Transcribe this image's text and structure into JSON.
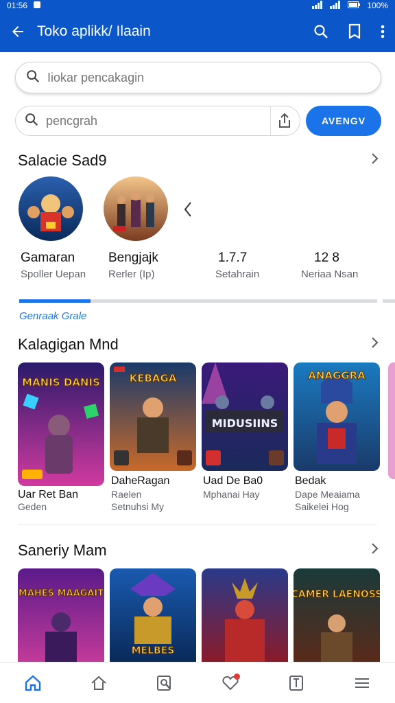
{
  "status": {
    "time": "01:56",
    "battery": "100%"
  },
  "appbar": {
    "title": "Toko aplikk/ Ilaain"
  },
  "search_main": {
    "placeholder": "Iiokar pencakagin"
  },
  "search_secondary": {
    "placeholder": "pencgrah"
  },
  "primary_button": {
    "label": "AVENGV"
  },
  "section1": {
    "title": "Salacie Sad9"
  },
  "stats": [
    {
      "value": "Gamaran",
      "label": "Spoller Uepan"
    },
    {
      "value": "Bengjajk",
      "label": "Rerler (Ip)"
    },
    {
      "value": "1.7.7",
      "label": "Setahrain"
    },
    {
      "value": "12 8",
      "label": "Neriaa Nsan"
    }
  ],
  "progress": {
    "fraction": 0.2
  },
  "link_text": "Genraak Grale",
  "section2": {
    "title": "Kalagigan Mnd",
    "cards": [
      {
        "art_text": "MANIS DANIS",
        "title": "Uar Ret Ban",
        "sub": "Geden"
      },
      {
        "art_text": "KEBAGA",
        "title": "DaheRagan",
        "sub": "Raelen"
      },
      {
        "art_text": "MIDUSIINS",
        "title": "Uad De Ba0",
        "sub": "Mphanai Hay"
      },
      {
        "art_text": "ANAGGRA",
        "title": "Bedak",
        "sub": "Dape Meaiama"
      }
    ],
    "card_extra_lines": [
      "",
      "Setnuhsi My",
      "",
      "Saikelei Hog"
    ]
  },
  "section3": {
    "title": "Saneriy Mam",
    "cards": [
      {
        "art_text": "MAHES MAAGAIT"
      },
      {
        "art_text": "MELBES"
      },
      {
        "art_text": ""
      },
      {
        "art_text": "CAMER LAENOSS"
      }
    ]
  },
  "colors": {
    "primary": "#0b57c9",
    "accent": "#1a73e8",
    "badge": "#e53935"
  },
  "nav": [
    "home-icon",
    "store-icon",
    "search-doc-icon",
    "heart-icon",
    "book-icon",
    "menu-icon"
  ]
}
